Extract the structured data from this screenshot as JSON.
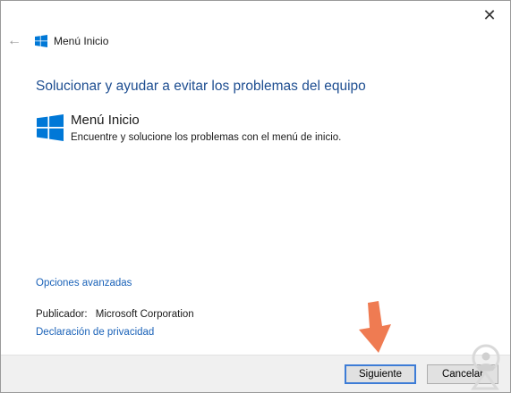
{
  "window": {
    "title": "Menú Inicio",
    "close_symbol": "✕",
    "back_symbol": "←"
  },
  "content": {
    "heading": "Solucionar y ayudar a evitar los problemas del equipo",
    "item": {
      "title": "Menú Inicio",
      "description": "Encuentre y solucione los problemas con el menú de inicio."
    },
    "advanced_link": "Opciones avanzadas",
    "publisher_label": "Publicador:",
    "publisher_value": "Microsoft Corporation",
    "privacy_link": "Declaración de privacidad"
  },
  "footer": {
    "next_label": "Siguiente",
    "cancel_label": "Cancelar"
  },
  "colors": {
    "accent": "#1e4e91",
    "link": "#1a62b8",
    "windows_logo": "#0078d7",
    "arrow": "#ef7b52"
  },
  "icons": {
    "title_logo": "windows-logo-icon",
    "item_logo": "windows-logo-icon",
    "arrow": "pointer-arrow-icon",
    "watermark": "watermark-logo-icon"
  }
}
